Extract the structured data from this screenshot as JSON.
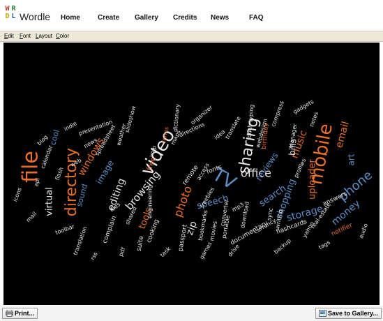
{
  "brand": {
    "logo_letters": [
      "W",
      "R",
      "D",
      "L"
    ],
    "logo_colors": [
      "#c0392b",
      "#2e7d32",
      "#c8a000",
      "#1f5fa8"
    ],
    "name": "Wordle"
  },
  "nav": [
    "Home",
    "Create",
    "Gallery",
    "Credits",
    "News",
    "FAQ"
  ],
  "menu": [
    {
      "accel": "E",
      "rest": "dit"
    },
    {
      "accel": "F",
      "rest": "ont"
    },
    {
      "accel": "L",
      "rest": "ayout"
    },
    {
      "accel": "C",
      "rest": "olor"
    }
  ],
  "cloud": {
    "background": "#000000",
    "palette": {
      "orange": "#e8702a",
      "blue": "#5b8fc7",
      "white": "#e8e8e8",
      "tan": "#c9a66b",
      "grey": "#9a9a9a"
    },
    "words": [
      {
        "t": "file",
        "c": "orange"
      },
      {
        "t": "directory",
        "c": "orange"
      },
      {
        "t": "video",
        "c": "white"
      },
      {
        "t": "sharing",
        "c": "white"
      },
      {
        "t": "mobile",
        "c": "orange"
      },
      {
        "t": "phone",
        "c": "blue"
      },
      {
        "t": "office",
        "c": "white"
      },
      {
        "t": "TV",
        "c": "blue"
      },
      {
        "t": "music",
        "c": "orange"
      },
      {
        "t": "email",
        "c": "orange"
      },
      {
        "t": "uploader",
        "c": "orange"
      },
      {
        "t": "browsing",
        "c": "white"
      },
      {
        "t": "editing",
        "c": "white"
      },
      {
        "t": "speech",
        "c": "blue"
      },
      {
        "t": "storage",
        "c": "blue"
      },
      {
        "t": "money",
        "c": "blue"
      },
      {
        "t": "photo",
        "c": "orange"
      },
      {
        "t": "tools",
        "c": "orange"
      },
      {
        "t": "zip",
        "c": "white"
      },
      {
        "t": "windows",
        "c": "orange"
      },
      {
        "t": "virtual",
        "c": "white"
      },
      {
        "t": "search",
        "c": "blue"
      },
      {
        "t": "shopping",
        "c": "blue"
      },
      {
        "t": "reviews",
        "c": "blue"
      },
      {
        "t": "bills",
        "c": "white"
      },
      {
        "t": "image",
        "c": "blue"
      },
      {
        "t": "art",
        "c": "blue"
      },
      {
        "t": "cool",
        "c": "blue"
      },
      {
        "t": "sound",
        "c": "blue"
      },
      {
        "t": "fonts",
        "c": "white"
      },
      {
        "t": "free",
        "c": "orange"
      },
      {
        "t": "notifier",
        "c": "orange"
      },
      {
        "t": "answers",
        "c": "white"
      },
      {
        "t": "documentary",
        "c": "white"
      },
      {
        "t": "flashcards",
        "c": "white"
      },
      {
        "t": "currency",
        "c": "white"
      },
      {
        "t": "passport",
        "c": "white"
      },
      {
        "t": "suite",
        "c": "white"
      },
      {
        "t": "complain",
        "c": "white"
      },
      {
        "t": "cooking",
        "c": "white"
      },
      {
        "t": "toolbar",
        "c": "white"
      },
      {
        "t": "icons",
        "c": "white"
      },
      {
        "t": "directions",
        "c": "white"
      },
      {
        "t": "freebies",
        "c": "white"
      },
      {
        "t": "gadgets",
        "c": "white"
      },
      {
        "t": "remote",
        "c": "white"
      },
      {
        "t": "access",
        "c": "white"
      },
      {
        "t": "presentation",
        "c": "white"
      },
      {
        "t": "voip",
        "c": "white"
      },
      {
        "t": "webdesign",
        "c": "white"
      },
      {
        "t": "notes",
        "c": "white"
      },
      {
        "t": "manager",
        "c": "white"
      },
      {
        "t": "yahoo",
        "c": "white"
      },
      {
        "t": "birthday",
        "c": "orange"
      },
      {
        "t": "profiles",
        "c": "white"
      },
      {
        "t": "translation",
        "c": "white"
      },
      {
        "t": "movies",
        "c": "white"
      },
      {
        "t": "shared",
        "c": "white"
      },
      {
        "t": "engineering",
        "c": "white"
      },
      {
        "t": "bookmarks",
        "c": "white"
      },
      {
        "t": "portable",
        "c": "white"
      },
      {
        "t": "download",
        "c": "white"
      },
      {
        "t": "converter",
        "c": "white"
      },
      {
        "t": "real-estate",
        "c": "white"
      },
      {
        "t": "mp3",
        "c": "white"
      },
      {
        "t": "writing",
        "c": "white"
      },
      {
        "t": "sync",
        "c": "white"
      },
      {
        "t": "idea",
        "c": "white"
      },
      {
        "t": "touch-typing",
        "c": "white"
      },
      {
        "t": "indie",
        "c": "white"
      },
      {
        "t": "maps",
        "c": "white"
      },
      {
        "t": "flash",
        "c": "white"
      },
      {
        "t": "mail",
        "c": "white"
      },
      {
        "t": "weather",
        "c": "white"
      },
      {
        "t": "forms",
        "c": "orange"
      },
      {
        "t": "news",
        "c": "white"
      },
      {
        "t": "spreadsheet",
        "c": "white"
      },
      {
        "t": "calendar",
        "c": "white"
      },
      {
        "t": "blog",
        "c": "white"
      },
      {
        "t": "translate",
        "c": "white"
      },
      {
        "t": "dictionary",
        "c": "white"
      },
      {
        "t": "organizer",
        "c": "white"
      },
      {
        "t": "compress",
        "c": "white"
      },
      {
        "t": "slideshow",
        "c": "white"
      },
      {
        "t": "web",
        "c": "white"
      },
      {
        "t": "files",
        "c": "white"
      },
      {
        "t": "api",
        "c": "white"
      },
      {
        "t": "tags",
        "c": "white"
      },
      {
        "t": "rss",
        "c": "white"
      },
      {
        "t": "pdf",
        "c": "white"
      },
      {
        "t": "task",
        "c": "white"
      },
      {
        "t": "drive",
        "c": "white"
      },
      {
        "t": "backup",
        "c": "white"
      },
      {
        "t": "games",
        "c": "white"
      },
      {
        "t": "audio",
        "c": "white"
      },
      {
        "t": "share",
        "c": "white"
      },
      {
        "t": "host",
        "c": "white"
      },
      {
        "t": "todo",
        "c": "white"
      },
      {
        "t": "wiki",
        "c": "white"
      },
      {
        "t": "lists",
        "c": "white"
      }
    ]
  },
  "buttons": {
    "print": "Print...",
    "save": "Save to Gallery..."
  }
}
